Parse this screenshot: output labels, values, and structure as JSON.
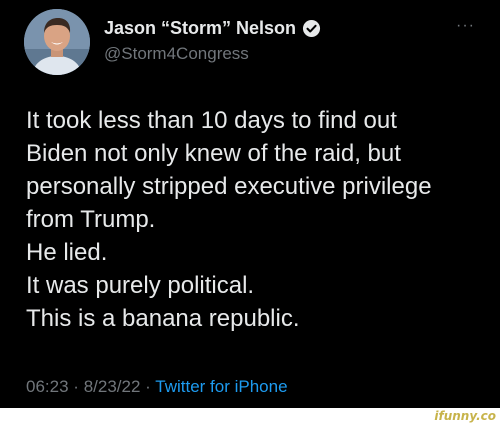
{
  "author": {
    "display_name": "Jason “Storm” Nelson",
    "handle": "@Storm4Congress",
    "verified": true
  },
  "more_menu": "···",
  "tweet": {
    "lines": [
      "It took less than 10 days to find out",
      "Biden not only knew of the raid, but",
      "personally stripped executive privilege",
      "from Trump.",
      "He lied.",
      "It was purely political.",
      "This is a banana republic."
    ]
  },
  "meta": {
    "time": "06:23",
    "separator": "·",
    "date": "8/23/22",
    "source": "Twitter for iPhone"
  },
  "watermark": "ifunny.co",
  "colors": {
    "background": "#000000",
    "text": "#e7e9ea",
    "secondary": "#71767b",
    "link": "#1d9bf0",
    "watermark": "#c7b34a"
  }
}
